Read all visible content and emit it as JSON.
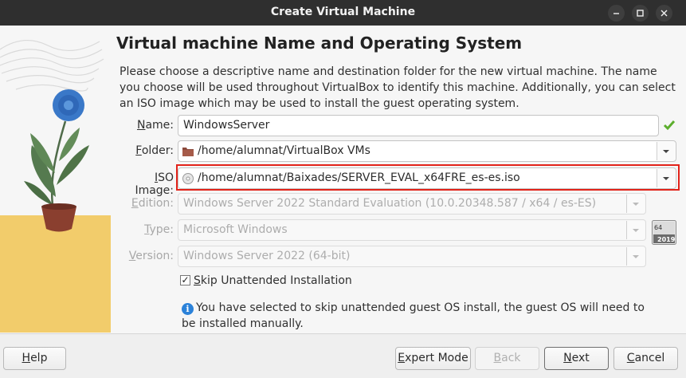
{
  "window": {
    "title": "Create Virtual Machine"
  },
  "page": {
    "heading": "Virtual machine Name and Operating System",
    "description": "Please choose a descriptive name and destination folder for the new virtual machine. The name you choose will be used throughout VirtualBox to identify this machine. Additionally, you can select an ISO image which may be used to install the guest operating system."
  },
  "form": {
    "name": {
      "label_mnemonic": "N",
      "label_rest": "ame:",
      "value": "WindowsServer"
    },
    "folder": {
      "label_mnemonic": "F",
      "label_rest": "older:",
      "value": "/home/alumnat/VirtualBox VMs"
    },
    "iso": {
      "label_mnemonic": "I",
      "label_rest": "SO Image:",
      "value": "/home/alumnat/Baixades/SERVER_EVAL_x64FRE_es-es.iso"
    },
    "edition": {
      "label_mnemonic": "E",
      "label_rest": "dition:",
      "value": "Windows Server 2022 Standard Evaluation (10.0.20348.587 / x64 / es-ES)"
    },
    "type": {
      "label_mnemonic": "T",
      "label_rest": "ype:",
      "value": "Microsoft Windows"
    },
    "version": {
      "label_mnemonic": "V",
      "label_rest": "ersion:",
      "value": "Windows Server 2022 (64-bit)"
    },
    "os_badge": {
      "arch": "64",
      "year": "2019"
    },
    "skip_unattended": {
      "checked": true,
      "check_glyph": "✓",
      "label_mnemonic": "S",
      "label_rest": "kip Unattended Installation"
    },
    "info_text": "You have selected to skip unattended guest OS install, the guest OS will need to be installed manually."
  },
  "buttons": {
    "help": {
      "mnemonic": "H",
      "rest": "elp"
    },
    "expert_mode": {
      "mnemonic": "E",
      "rest": "xpert Mode"
    },
    "back": {
      "mnemonic": "B",
      "rest": "ack"
    },
    "next": {
      "mnemonic": "N",
      "rest": "ext"
    },
    "cancel": {
      "mnemonic": "C",
      "rest": "ancel"
    }
  },
  "colors": {
    "highlight": "#e2231a",
    "accent": "#2b82d9",
    "titlebar": "#2f2f2f"
  }
}
